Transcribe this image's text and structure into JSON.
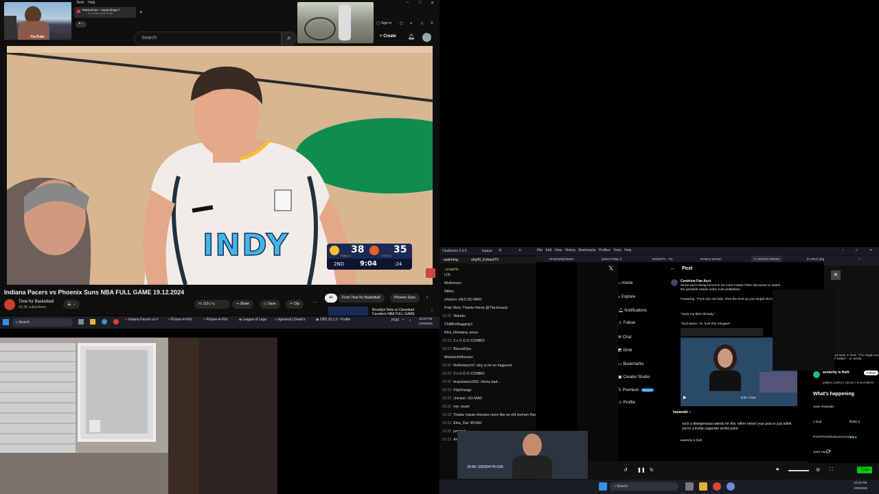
{
  "youtube": {
    "menu": [
      "Tools",
      "Help"
    ],
    "pip_tab_title": "Mamachan - Aquariology F",
    "pip_tab_sub": "PICTURE-IN-PICTURE",
    "logo_text": "YouTube",
    "search_placeholder": "Search",
    "sign_in": "Sign in",
    "create": "Create",
    "video_title": "Indiana Pacers vs Phoenix Suns NBA FULL GAME 19.12.2024",
    "channel": "Time for Basketball",
    "subscribers": "25.3K subscribers",
    "likes": "119",
    "share": "Share",
    "save": "Save",
    "clip": "Clip",
    "chips": [
      "All",
      "From Time for Basketball",
      "Phoenix Suns"
    ],
    "rec_title": "Brooklyn Nets vs Cleveland Cavaliers NBA FULL GAME",
    "jersey_text": "INDY",
    "score": {
      "home": "38",
      "away": "35",
      "home_fouls": "FOULS 2",
      "away_fouls": "FOULS 1",
      "period": "2ND",
      "clock": "9:04",
      "shot_clock": ":24"
    }
  },
  "taskbar_top": {
    "search": "Search",
    "apps": [
      "Indiana Pacers vs F",
      "Picture-in-Pict",
      "Picture-in-Pict",
      "League of Lege",
      "#general | Dinah's",
      "OBS 32.1.0 - Profile"
    ],
    "lang": "POR",
    "time": "10:22 PM",
    "date": "2/29/2026"
  },
  "chatterino": {
    "title": "Chatterino 2.5.5",
    "user": "kutaye",
    "tabs": [
      "watching",
      "shy00_EsfandTV"
    ],
    "channel_tab": "yougelle",
    "lines": [
      {
        "ts": "",
        "text": "LOL"
      },
      {
        "ts": "",
        "text": "Wuforever:"
      },
      {
        "ts": "",
        "text": "Nithix:"
      },
      {
        "ts": "",
        "text": "chicken: HES SO MAD"
      },
      {
        "ts": "",
        "text": "Friar-Sten: Thanks friend @TheJonavic"
      },
      {
        "ts": "22:22",
        "text": "Nelude:"
      },
      {
        "ts": "",
        "text": "ChillBroBagging7:"
      },
      {
        "ts": "",
        "text": "Rick_Montana: jesus"
      },
      {
        "ts": "22:22",
        "text": "2 x C-C-C-COMBO"
      },
      {
        "ts": "22:22",
        "text": "BiscuitOps:"
      },
      {
        "ts": "",
        "text": "MelatoninMisuser:"
      },
      {
        "ts": "22:22",
        "text": "RutheniumVI: why is he so triggered"
      },
      {
        "ts": "22:22",
        "text": "2 x C-C-C-COMBO"
      },
      {
        "ts": "22:22",
        "text": "brasstacks1991: Dems bad..."
      },
      {
        "ts": "22:22",
        "text": "FlipOrange:"
      },
      {
        "ts": "22:22",
        "text": "chicken: SO MAD"
      },
      {
        "ts": "22:22",
        "text": "rep: woah"
      },
      {
        "ts": "22:22",
        "text": "Triada: hasan dresses more like an old woman than she does"
      },
      {
        "ts": "22:22",
        "text": "Elea_Dai: WOAH"
      },
      {
        "ts": "22:22",
        "text": "junknot:"
      },
      {
        "ts": "22:22",
        "text": "AngryPunkGranny: ICE depart Hasan he admits he's an anchor baby."
      }
    ]
  },
  "browser": {
    "menu": [
      "File",
      "Edit",
      "View",
      "History",
      "Bookmarks",
      "Profiles",
      "Tools",
      "Help"
    ],
    "tabs": [
      "NinaDaddyisBack",
      "Quick Friday S",
      "EsfandTV - Tw",
      "Destiny Stream",
      "ontrack1 Stream",
      "[CHINA] abg"
    ],
    "tab_sub": "PICTURE-IN-PICTURE"
  },
  "xpost": {
    "header": "Post",
    "nav": [
      "Home",
      "Explore",
      "Notifications",
      "Follow",
      "Chat",
      "Grok",
      "Bookmarks",
      "Creator Studio",
      "Premium",
      "Profile"
    ],
    "premium_badge": "Activate",
    "author": "Centrism Fan Acct",
    "body1": "Since we're being forced to do more Hasan Piker discourse to watch the greatest Hasan video ever published.",
    "body2": "Featuring: \"Fuck you old lady. Shut the fuck up you stupid old lady\"",
    "body3": "\"Suck my dick old lady.\"",
    "body4": "\"God damn. Yo, fuck this refugee!\"",
    "video_time": "0:01 / 0:54",
    "reply_author": "hasanabi",
    "reply_text": "such a disingenuous weirdo for this. either retract your post or just admit you're a trump supporter at this point.",
    "reply2_author": "austerity is theft",
    "whats_happening": "What's happening",
    "follow_name": "austerity is theft",
    "follow_bio": "politics | policy | soccer | & journalism",
    "follow_btn": "Follow",
    "food_text": "thinks I have good taste in food. \"The single worst account on all of Twitter\" - D. Sirota",
    "trends": [
      "Jose Alvarado",
      "J Dub",
      "#TurnPIANOintoAnAcronym",
      "Josh Hart"
    ],
    "side_text": "thats a"
  },
  "player": {
    "time": "29:46 / 256204778 0:55"
  },
  "taskbar_bottom": {
    "search": "Search",
    "time": "10:22 PM",
    "date": "2/29/2026"
  },
  "colors": {
    "youtube_red": "#ff0000",
    "pacers_navy": "#1b2a55",
    "pacers_yellow": "#fdbb30",
    "suns_orange": "#e56020",
    "chat_green": "#00c800"
  }
}
